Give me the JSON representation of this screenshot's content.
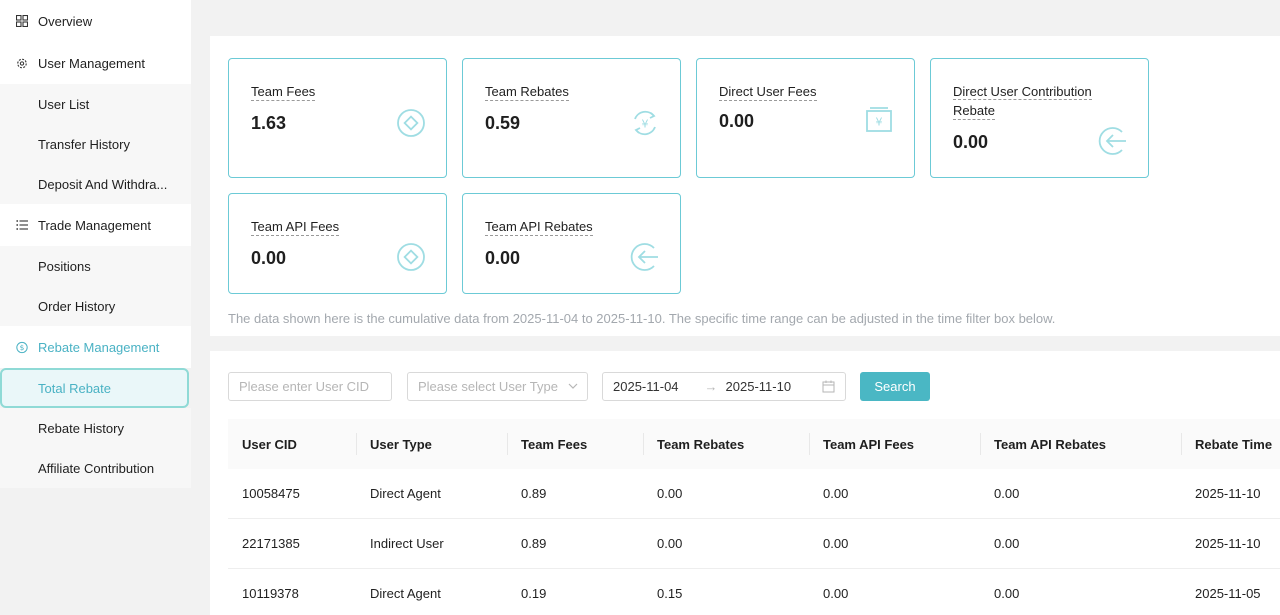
{
  "sidebar": {
    "overview": "Overview",
    "user_management": "User Management",
    "user_management_items": [
      "User List",
      "Transfer History",
      "Deposit And Withdra..."
    ],
    "trade_management": "Trade Management",
    "trade_management_items": [
      "Positions",
      "Order History"
    ],
    "rebate_management": "Rebate Management",
    "rebate_management_items": [
      "Total Rebate",
      "Rebate History",
      "Affiliate Contribution"
    ]
  },
  "stats": {
    "team_fees": {
      "label": "Team Fees",
      "value": "1.63"
    },
    "team_rebates": {
      "label": "Team Rebates",
      "value": "0.59"
    },
    "direct_user_fees": {
      "label": "Direct User Fees",
      "value": "0.00"
    },
    "direct_user_contribution_rebate": {
      "label_line1": "Direct User Contribution",
      "label_line2": "Rebate",
      "value": "0.00"
    },
    "team_api_fees": {
      "label": "Team API Fees",
      "value": "0.00"
    },
    "team_api_rebates": {
      "label": "Team API Rebates",
      "value": "0.00"
    }
  },
  "note": "The data shown here is the cumulative data from 2025-11-04 to 2025-11-10. The specific time range can be adjusted in the time filter box below.",
  "filters": {
    "user_cid_placeholder": "Please enter User CID",
    "user_type_placeholder": "Please select User Type",
    "date_start": "2025-11-04",
    "date_arrow": "→",
    "date_end": "2025-11-10",
    "search_label": "Search"
  },
  "table": {
    "headers": [
      "User CID",
      "User Type",
      "Team Fees",
      "Team Rebates",
      "Team API Fees",
      "Team API Rebates",
      "Rebate Time"
    ],
    "rows": [
      [
        "10058475",
        "Direct Agent",
        "0.89",
        "0.00",
        "0.00",
        "0.00",
        "2025-11-10"
      ],
      [
        "22171385",
        "Indirect User",
        "0.89",
        "0.00",
        "0.00",
        "0.00",
        "2025-11-10"
      ],
      [
        "10119378",
        "Direct Agent",
        "0.19",
        "0.15",
        "0.00",
        "0.00",
        "2025-11-05"
      ]
    ]
  },
  "colors": {
    "accent": "#4ab2c4",
    "card_border": "#6ccad6",
    "search_button": "#4ab7c4"
  }
}
